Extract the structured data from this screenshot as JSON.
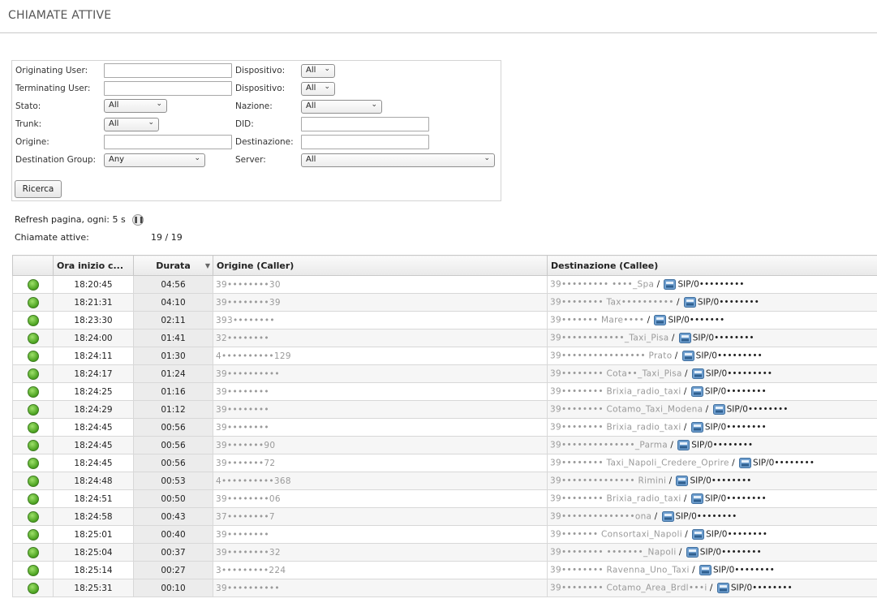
{
  "page": {
    "title": "CHIAMATE ATTIVE"
  },
  "filters": {
    "originating_user_label": "Originating User:",
    "terminating_user_label": "Terminating User:",
    "stato_label": "Stato:",
    "trunk_label": "Trunk:",
    "origine_label": "Origine:",
    "destination_group_label": "Destination Group:",
    "dispositivo1_label": "Dispositivo:",
    "dispositivo2_label": "Dispositivo:",
    "nazione_label": "Nazione:",
    "did_label": "DID:",
    "destinazione_label": "Destinazione:",
    "server_label": "Server:",
    "stato_value": "All",
    "trunk_value": "All",
    "destination_group_value": "Any",
    "dispositivo1_value": "All",
    "dispositivo2_value": "All",
    "nazione_value": "All",
    "server_value": "All",
    "search_button": "Ricerca"
  },
  "refresh": {
    "label": "Refresh pagina, ogni: 5 s"
  },
  "active": {
    "label": "Chiamate attive:",
    "count": "19 / 19"
  },
  "table": {
    "headers": {
      "start": "Ora inizio c...",
      "duration": "Durata",
      "caller": "Origine (Caller)",
      "callee": "Destinazione (Callee)"
    },
    "rows": [
      {
        "start": "18:20:45",
        "duration": "04:56",
        "caller": "39••••••••30",
        "callee_name": "39••••••••• ••••_Spa",
        "callee_sip": "SIP/0•••••••••"
      },
      {
        "start": "18:21:31",
        "duration": "04:10",
        "caller": "39••••••••39",
        "callee_name": "39•••••••• Tax••••••••••",
        "callee_sip": "SIP/0••••••••"
      },
      {
        "start": "18:23:30",
        "duration": "02:11",
        "caller": "393••••••••",
        "callee_name": "39••••••• Mare••••",
        "callee_sip": "SIP/0•••••••"
      },
      {
        "start": "18:24:00",
        "duration": "01:41",
        "caller": "32••••••••",
        "callee_name": "39••••••••••••_Taxi_Pisa",
        "callee_sip": "SIP/0••••••••"
      },
      {
        "start": "18:24:11",
        "duration": "01:30",
        "caller": "4••••••••••129",
        "callee_name": "39•••••••••••••••• Prato",
        "callee_sip": "SIP/0•••••••••"
      },
      {
        "start": "18:24:17",
        "duration": "01:24",
        "caller": "39••••••••••",
        "callee_name": "39•••••••• Cota••_Taxi_Pisa",
        "callee_sip": "SIP/0•••••••••"
      },
      {
        "start": "18:24:25",
        "duration": "01:16",
        "caller": "39••••••••",
        "callee_name": "39•••••••• Brixia_radio_taxi",
        "callee_sip": "SIP/0••••••••"
      },
      {
        "start": "18:24:29",
        "duration": "01:12",
        "caller": "39••••••••",
        "callee_name": "39•••••••• Cotamo_Taxi_Modena",
        "callee_sip": "SIP/0••••••••"
      },
      {
        "start": "18:24:45",
        "duration": "00:56",
        "caller": "39••••••••",
        "callee_name": "39•••••••• Brixia_radio_taxi",
        "callee_sip": "SIP/0••••••••"
      },
      {
        "start": "18:24:45",
        "duration": "00:56",
        "caller": "39•••••••90",
        "callee_name": "39••••••••••••••_Parma",
        "callee_sip": "SIP/0••••••••"
      },
      {
        "start": "18:24:45",
        "duration": "00:56",
        "caller": "39•••••••72",
        "callee_name": "39•••••••• Taxi_Napoli_Credere_Oprire",
        "callee_sip": "SIP/0••••••••"
      },
      {
        "start": "18:24:48",
        "duration": "00:53",
        "caller": "4••••••••••368",
        "callee_name": "39•••••••••••••• Rimini",
        "callee_sip": "SIP/0••••••••"
      },
      {
        "start": "18:24:51",
        "duration": "00:50",
        "caller": "39••••••••06",
        "callee_name": "39•••••••• Brixia_radio_taxi",
        "callee_sip": "SIP/0••••••••"
      },
      {
        "start": "18:24:58",
        "duration": "00:43",
        "caller": "37••••••••7",
        "callee_name": "39••••••••••••••ona",
        "callee_sip": "SIP/0••••••••"
      },
      {
        "start": "18:25:01",
        "duration": "00:40",
        "caller": "39••••••••",
        "callee_name": "39••••••• Consortaxi_Napoli",
        "callee_sip": "SIP/0••••••••"
      },
      {
        "start": "18:25:04",
        "duration": "00:37",
        "caller": "39••••••••32",
        "callee_name": "39•••••••• •••••••_Napoli",
        "callee_sip": "SIP/0••••••••"
      },
      {
        "start": "18:25:14",
        "duration": "00:27",
        "caller": "3•••••••••224",
        "callee_name": "39•••••••• Ravenna_Uno_Taxi",
        "callee_sip": "SIP/0••••••••"
      },
      {
        "start": "18:25:31",
        "duration": "00:10",
        "caller": "39••••••••••",
        "callee_name": "39•••••••• Cotamo_Area_Brdl•••i",
        "callee_sip": "SIP/0••••••••"
      }
    ]
  },
  "colors": {
    "status_active": "#4aa11f",
    "header_bg": "#e9e9e9",
    "border": "#c8c8c8"
  }
}
